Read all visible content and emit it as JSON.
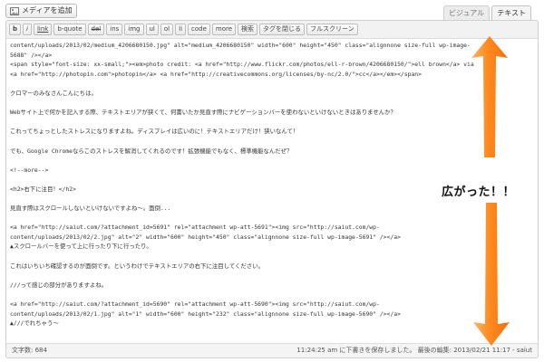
{
  "media_button": {
    "label": "メディアを追加"
  },
  "mode_tabs": [
    {
      "label": "ビジュアル",
      "active": false
    },
    {
      "label": "テキスト",
      "active": true
    }
  ],
  "quicktags": [
    "b",
    "i",
    "link",
    "b-quote",
    "del",
    "ins",
    "img",
    "ul",
    "ol",
    "li",
    "code",
    "more",
    "検索",
    "タグを閉じる",
    "フルスクリーン"
  ],
  "content_lines": [
    "content/uploads/2013/02/medium_4206680150.jpg\" alt=\"medium_4206680150\" width=\"600\" height=\"450\" class=\"alignnone size-full wp-image-",
    "5688\" /></a>",
    "<span style=\"font-size: xx-small;\"><em>photo credit: <a href=\"http://www.flickr.com/photos/ell-r-brown/4206680150/\">ell brown</a> via",
    "<a href=\"http://photopin.com\">photopin</a> <a href=\"http://creativecommons.org/licenses/by-nc/2.0/\">cc</a></em></span>",
    "",
    "クロマーのみなさんこんにちは。",
    "",
    "Webサイト上で何かを記入する際、テキストエリアが狭くて、何書いたか見直す際にナビゲーションバーを使わないといけないときはありませんか？",
    "",
    "これってちょっとしたストレスになりますよね。ディスプレイは広いのに！テキストエリアだけ！狭いなんて！",
    "",
    "でも、Google Chromeならこのストレスを解消してくれるのです！拡張機能でもなく、標準機能なんだぜ？",
    "",
    "<!--more-->",
    "",
    "<h2>右下に注目！</h2>",
    "",
    "見直す際はスクロールしないといけないですよね〜。面倒...",
    "",
    "<a href=\"http://saiut.com/?attachment_id=5691\" rel=\"attachment wp-att-5691\"><img src=\"http://saiut.com/wp-",
    "content/uploads/2013/02/2.jpg\" alt=\"2\" width=\"600\" height=\"450\" class=\"alignnone size-full wp-image-5691\" /></a>",
    "▲スクロールバーを使って上に行ったり下に行ったり。",
    "",
    "これはいちいち確認するのが面倒です。というわけでテキストエリアの右下に注目してください。",
    "",
    "///って感じの部分がありますよね。",
    "",
    "<a href=\"http://saiut.com/?attachment_id=5690\" rel=\"attachment wp-att-5690\"><img src=\"http://saiut.com/wp-",
    "content/uploads/2013/02/1.jpg\" alt=\"1\" width=\"600\" height=\"232\" class=\"alignnone size-full wp-image-5690\" /></a>",
    "▲///でれちゃう〜"
  ],
  "status_bar": {
    "word_count": "文字数: 684",
    "save_status": "11:24:25 am に下書きを保存しました。 最後の編集: 2013/02/21 11:17 - saiut"
  },
  "annotation": {
    "text": "広がった！！"
  },
  "colors": {
    "arrow": "#ff7f11",
    "arrow_light": "#ffb566"
  }
}
